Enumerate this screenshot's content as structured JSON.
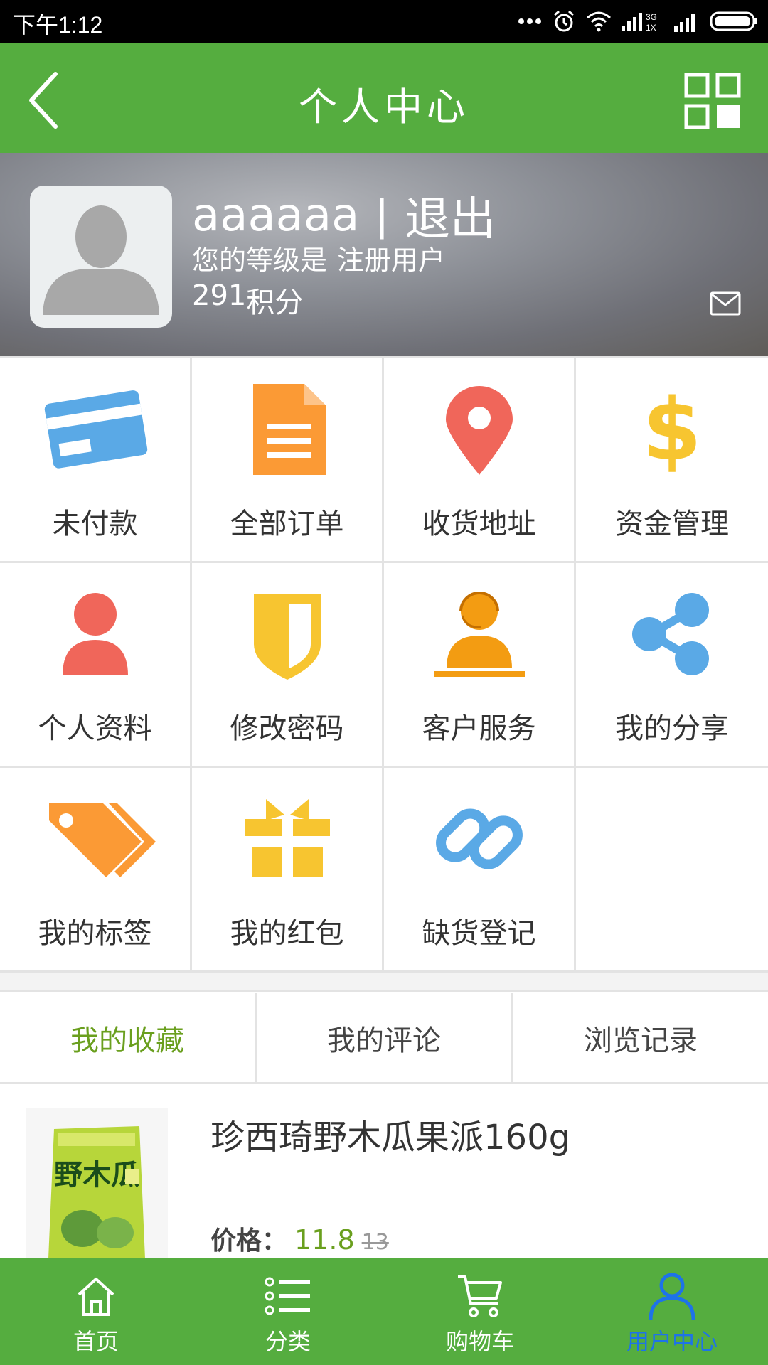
{
  "status_bar": {
    "time": "下午1:12",
    "network": "3G 1X"
  },
  "header": {
    "title": "个人中心"
  },
  "profile": {
    "username": "aaaaaa",
    "separator": "|",
    "logout": "退出",
    "level_prefix": "您的等级是",
    "level": "注册用户",
    "points": "291",
    "points_unit": "积分"
  },
  "menu": {
    "items": [
      {
        "label": "未付款",
        "icon": "credit-card-icon",
        "color": "#5aa9e6"
      },
      {
        "label": "全部订单",
        "icon": "document-icon",
        "color": "#fb9a35"
      },
      {
        "label": "收货地址",
        "icon": "location-pin-icon",
        "color": "#f0665a"
      },
      {
        "label": "资金管理",
        "icon": "dollar-icon",
        "color": "#f7c530"
      },
      {
        "label": "个人资料",
        "icon": "user-icon",
        "color": "#f0665a"
      },
      {
        "label": "修改密码",
        "icon": "shield-icon",
        "color": "#f7c530"
      },
      {
        "label": "客户服务",
        "icon": "customer-service-icon",
        "color": "#f39c12"
      },
      {
        "label": "我的分享",
        "icon": "share-icon",
        "color": "#5aa9e6"
      },
      {
        "label": "我的标签",
        "icon": "tag-icon",
        "color": "#fb9a35"
      },
      {
        "label": "我的红包",
        "icon": "gift-icon",
        "color": "#f7c530"
      },
      {
        "label": "缺货登记",
        "icon": "link-icon",
        "color": "#5aa9e6"
      }
    ]
  },
  "tabs": [
    {
      "label": "我的收藏",
      "active": true
    },
    {
      "label": "我的评论",
      "active": false
    },
    {
      "label": "浏览记录",
      "active": false
    }
  ],
  "product": {
    "name": "珍西琦野木瓜果派160g",
    "price_label": "价格：",
    "price": "11.8",
    "old_price": "13",
    "thumb_text": "野木瓜"
  },
  "bottom_nav": [
    {
      "label": "首页",
      "icon": "home-icon",
      "active": false
    },
    {
      "label": "分类",
      "icon": "list-icon",
      "active": false
    },
    {
      "label": "购物车",
      "icon": "cart-icon",
      "active": false
    },
    {
      "label": "用户中心",
      "icon": "user-center-icon",
      "active": true
    }
  ],
  "colors": {
    "brand_green": "#55ad3f",
    "accent_green": "#6a9f1e",
    "active_blue": "#1e73e8"
  }
}
